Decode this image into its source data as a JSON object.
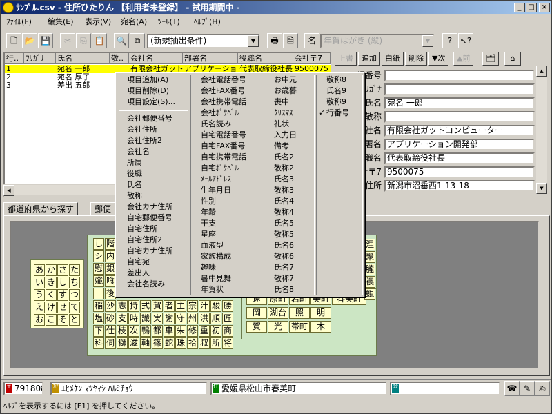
{
  "window": {
    "title": "ｻﾝﾌﾟﾙ.csv - 住所ひたりん 【利用者未登録】 - 試用期間中 -",
    "minimize": "_",
    "maximize": "□",
    "close": "×"
  },
  "menubar": [
    "ﾌｧｲﾙ(F)",
    "編集(E)",
    "表示(V)",
    "宛名(A)",
    "ﾂｰﾙ(T)",
    "ﾍﾙﾌﾟ(H)"
  ],
  "toolbar": {
    "filter_value": "(新規抽出条件)",
    "layout_value": "年賀はがき (縦)"
  },
  "grid": {
    "columns": [
      "行..",
      "ﾌﾘｶﾞﾅ",
      "氏名",
      "敬..",
      "会社名",
      "部署名",
      "役職名",
      "会社〒7"
    ],
    "rows": [
      {
        "no": "1",
        "kana": "",
        "name": "宛名 一郎",
        "honor": "",
        "company": "有限会社ガットコ",
        "dept": "アプリケーション開",
        "title": "代表取締役社長",
        "zip": "9500075"
      },
      {
        "no": "2",
        "kana": "",
        "name": "宛名 厚子",
        "honor": "",
        "company": "",
        "dept": "",
        "title": "",
        "zip": ""
      },
      {
        "no": "3",
        "kana": "",
        "name": "差出 五郎",
        "honor": "",
        "company": "",
        "dept": "",
        "title": "",
        "zip": ""
      }
    ]
  },
  "detail": {
    "buttons": [
      "上書",
      "追加",
      "白紙",
      "削除",
      "▼次",
      "▲前"
    ],
    "fields": [
      {
        "label": "行番号",
        "value": ""
      },
      {
        "label": "ﾌﾘｶﾞﾅ",
        "value": ""
      },
      {
        "label": "氏名",
        "value": "宛名 一郎"
      },
      {
        "label": "敬称",
        "value": ""
      },
      {
        "label": "会社名",
        "value": "有限会社ガットコンピューター"
      },
      {
        "label": "部署名",
        "value": "アプリケーション開発部"
      },
      {
        "label": "役職名",
        "value": "代表取締役社長"
      },
      {
        "label": "会社〒7",
        "value": "9500075"
      },
      {
        "label": "会社住所",
        "value": "新潟市沼垂西1-13-18"
      }
    ]
  },
  "tabs": [
    "都道府県から探す",
    "郵便"
  ],
  "context_menu": {
    "col1": [
      "項目追加(A)",
      "項目削除(D)",
      "項目設定(S)...",
      "-",
      "会社郵便番号",
      "会社住所",
      "会社住所2",
      "会社名",
      "所属",
      "役職",
      "氏名",
      "敬称",
      "会社カナ住所",
      "自宅郵便番号",
      "自宅住所",
      "自宅住所2",
      "自宅カナ住所",
      "自宅宛",
      "差出人",
      "会社名読み"
    ],
    "col2": [
      "会社電話番号",
      "会社FAX番号",
      "会社携帯電話",
      "会社ﾎﾟｹﾍﾞﾙ",
      "氏名読み",
      "自宅電話番号",
      "自宅FAX番号",
      "自宅携帯電話",
      "自宅ﾎﾟｹﾍﾞﾙ",
      "ﾒｰﾙｱﾄﾞﾚｽ",
      "生年月日",
      "性別",
      "年齢",
      "干支",
      "星座",
      "血液型",
      "家族構成",
      "趣味",
      "暑中見舞",
      "年賀状"
    ],
    "col3": [
      "お中元",
      "お歳暮",
      "喪中",
      "ｸﾘｽﾏｽ",
      "礼状",
      "入力日",
      "備考",
      "氏名2",
      "敬称2",
      "氏名3",
      "敬称3",
      "氏名4",
      "敬称4",
      "氏名5",
      "敬称5",
      "氏名6",
      "敬称6",
      "氏名7",
      "敬称7",
      "氏名8"
    ],
    "col4": [
      "敬称8",
      "氏名9",
      "敬称9",
      "行番号"
    ],
    "checked": "行番号"
  },
  "kana_card": {
    "rows": [
      [
        "あ",
        "か",
        "さ",
        "た"
      ],
      [
        "い",
        "き",
        "し",
        "ち"
      ],
      [
        "う",
        "く",
        "す",
        "つ"
      ],
      [
        "え",
        "け",
        "せ",
        "て"
      ],
      [
        "お",
        "こ",
        "そ",
        "と"
      ]
    ]
  },
  "kanji_card": {
    "rows": [
      [
        "稲",
        "沙",
        "志",
        "持",
        "式",
        "賀",
        "者",
        "主",
        "宗",
        "汁",
        "駿",
        "勝"
      ],
      [
        "塩",
        "砂",
        "支",
        "時",
        "識",
        "実",
        "謝",
        "守",
        "州",
        "洪",
        "順",
        "匠"
      ],
      [
        "下",
        "仕",
        "枝",
        "次",
        "鴨",
        "都",
        "車",
        "朱",
        "修",
        "重",
        "初",
        "商"
      ],
      [
        "科",
        "伺",
        "獅",
        "滋",
        "軸",
        "篠",
        "蛇",
        "珠",
        "拾",
        "叔",
        "所",
        "将"
      ]
    ],
    "left_col": [
      "し",
      "シ",
      "慰",
      "殲",
      "一"
    ],
    "left_col2": [
      "階",
      "内",
      "銀",
      "喰",
      "後"
    ]
  },
  "place_card": {
    "rows": [
      [
        "遠",
        "原町",
        "若町",
        "美町"
      ],
      [
        "岡",
        "湖台",
        "照",
        "明"
      ],
      [
        "賀",
        "光",
        "帯町",
        "木"
      ]
    ],
    "side": "春美町",
    "right_col": [
      "浬",
      "聚",
      "朧",
      "襖",
      "蜆"
    ]
  },
  "status": {
    "zip": "7918087",
    "kana": "ｴﾋﾒｹﾝ ﾏﾂﾔﾏｼ ﾊﾙﾐﾁｮｳ",
    "address": "愛媛県松山市春美町",
    "company": ""
  },
  "help_text": "ﾍﾙﾌﾟを表示するには [F1] を押してください。"
}
